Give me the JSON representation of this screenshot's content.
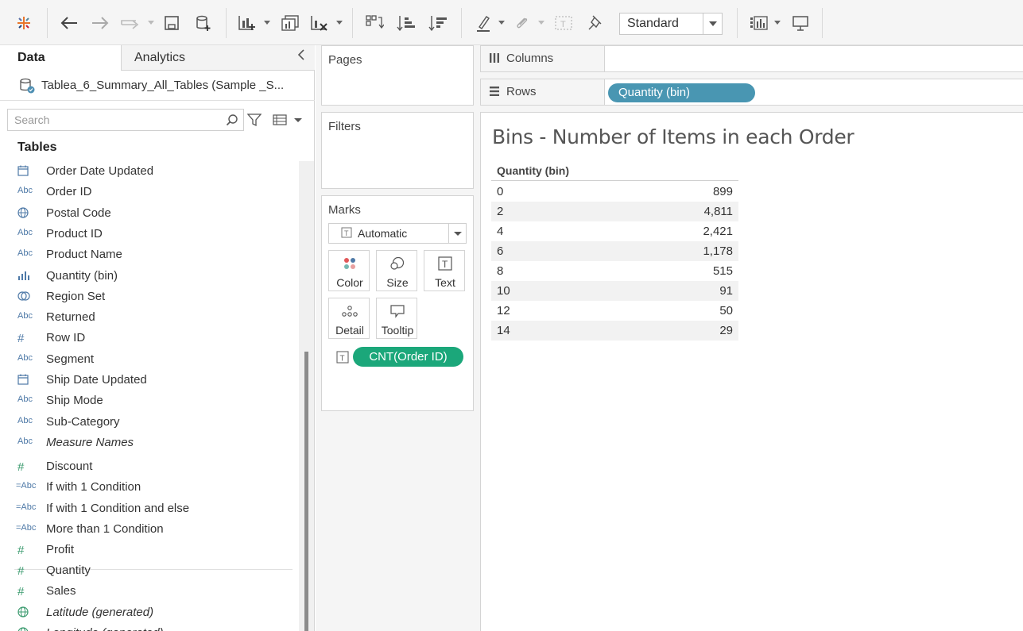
{
  "toolbar": {
    "view_mode": "Standard"
  },
  "data_pane": {
    "tabs": [
      "Data",
      "Analytics"
    ],
    "datasource": "Tablea_6_Summary_All_Tables (Sample _S...",
    "search_placeholder": "Search",
    "tables_header": "Tables",
    "fields": [
      {
        "type": "calendar-icon",
        "label": "Order Date Updated"
      },
      {
        "type": "abc",
        "label": "Order ID"
      },
      {
        "type": "globe-icon",
        "label": "Postal Code"
      },
      {
        "type": "abc",
        "label": "Product ID"
      },
      {
        "type": "abc",
        "label": "Product Name"
      },
      {
        "type": "bin-icon",
        "label": "Quantity (bin)"
      },
      {
        "type": "set-icon",
        "label": "Region Set"
      },
      {
        "type": "abc",
        "label": "Returned"
      },
      {
        "type": "hash",
        "label": "Row ID"
      },
      {
        "type": "abc",
        "label": "Segment"
      },
      {
        "type": "calendar-icon",
        "label": "Ship Date Updated"
      },
      {
        "type": "abc",
        "label": "Ship Mode"
      },
      {
        "type": "abc",
        "label": "Sub-Category"
      },
      {
        "type": "abc",
        "label": "Measure Names",
        "italic": true
      },
      {
        "type": "hash-measure",
        "label": "Discount"
      },
      {
        "type": "calc-abc",
        "label": "If with 1 Condition"
      },
      {
        "type": "calc-abc",
        "label": "If with 1 Condition and else"
      },
      {
        "type": "calc-abc",
        "label": "More than 1 Condition"
      },
      {
        "type": "hash-measure",
        "label": "Profit"
      },
      {
        "type": "hash-measure",
        "label": "Quantity"
      },
      {
        "type": "hash-measure",
        "label": "Sales"
      },
      {
        "type": "globe-measure",
        "label": "Latitude (generated)",
        "italic": true
      },
      {
        "type": "globe-measure",
        "label": "Longitude (generated)",
        "italic": true
      }
    ],
    "type_glyphs": {
      "abc": "Abc",
      "calc-abc": "=Abc",
      "hash": "#",
      "hash-measure": "#"
    }
  },
  "shelves": {
    "pages": "Pages",
    "filters": "Filters",
    "marks": "Marks",
    "mark_type": "Automatic",
    "mark_buttons": [
      "Color",
      "Size",
      "Text",
      "Detail",
      "Tooltip"
    ],
    "marks_pill": "CNT(Order ID)",
    "columns": "Columns",
    "rows": "Rows",
    "rows_pill": "Quantity (bin)"
  },
  "viz": {
    "title": "Bins - Number of Items in each Order",
    "column_header": "Quantity (bin)",
    "rows": [
      {
        "bin": "0",
        "count": "899"
      },
      {
        "bin": "2",
        "count": "4,811"
      },
      {
        "bin": "4",
        "count": "2,421"
      },
      {
        "bin": "6",
        "count": "1,178"
      },
      {
        "bin": "8",
        "count": "515"
      },
      {
        "bin": "10",
        "count": "91"
      },
      {
        "bin": "12",
        "count": "50"
      },
      {
        "bin": "14",
        "count": "29"
      }
    ]
  },
  "colors": {
    "rows_pill": "#4996b2",
    "measure_pill": "#1ba77a",
    "dimension_icon": "#4e79a7",
    "measure_icon": "#3a9a6e"
  }
}
